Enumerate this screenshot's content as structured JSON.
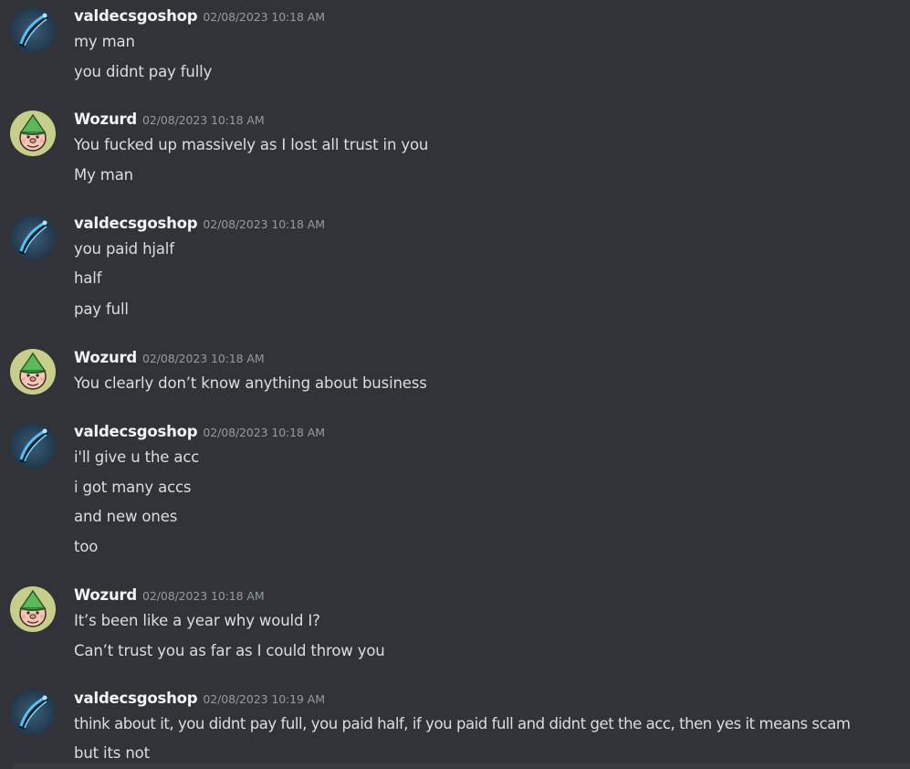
{
  "messages": [
    {
      "author": "valdecsgoshop",
      "avatar": "valde-avatar-icon",
      "timestamp": "02/08/2023 10:18 AM",
      "lines": [
        "my man",
        "you didnt pay fully"
      ]
    },
    {
      "author": "Wozurd",
      "avatar": "wozurd-avatar-icon",
      "timestamp": "02/08/2023 10:18 AM",
      "lines": [
        "You fucked up massively as I lost all trust in you",
        "My man"
      ]
    },
    {
      "author": "valdecsgoshop",
      "avatar": "valde-avatar-icon",
      "timestamp": "02/08/2023 10:18 AM",
      "lines": [
        "you paid hjalf",
        "half",
        "pay full"
      ]
    },
    {
      "author": "Wozurd",
      "avatar": "wozurd-avatar-icon",
      "timestamp": "02/08/2023 10:18 AM",
      "lines": [
        "You clearly don’t know anything about business"
      ]
    },
    {
      "author": "valdecsgoshop",
      "avatar": "valde-avatar-icon",
      "timestamp": "02/08/2023 10:18 AM",
      "lines": [
        "i'll give u the acc",
        "i got many accs",
        "and new ones",
        "too"
      ]
    },
    {
      "author": "Wozurd",
      "avatar": "wozurd-avatar-icon",
      "timestamp": "02/08/2023 10:18 AM",
      "lines": [
        "It’s been like a year why would I?",
        "Can’t trust you as far as I could throw you"
      ]
    },
    {
      "author": "valdecsgoshop",
      "avatar": "valde-avatar-icon",
      "timestamp": "02/08/2023 10:19 AM",
      "lines": [
        "think about it, you didnt pay full, you paid half, if you paid full and didnt get the acc, then yes it means scam",
        "but its not"
      ]
    }
  ],
  "colors": {
    "background": "#313338",
    "username": "#f2f3f5",
    "timestamp": "#949ba4",
    "text": "#dbdee1"
  }
}
